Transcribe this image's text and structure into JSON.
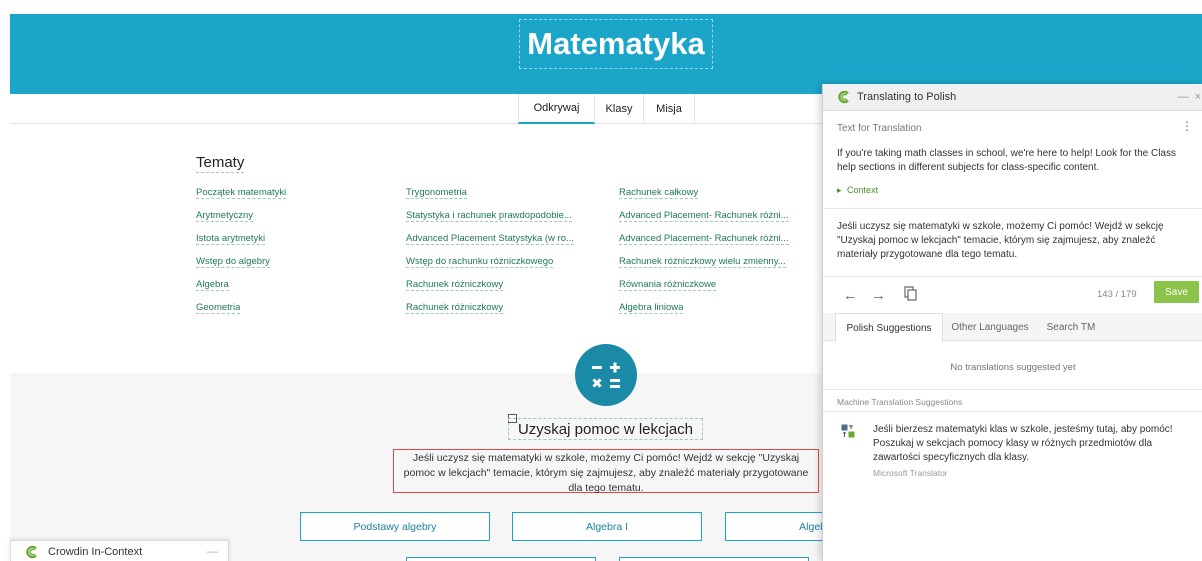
{
  "site": {
    "title": "Matematyka",
    "subnav": [
      "Odkrywaj",
      "Klasy",
      "Misja"
    ],
    "topics_heading": "Tematy",
    "topics": {
      "col1": [
        "Początek matematyki",
        "Arytmetyczny",
        "Istota arytmetyki",
        "Wstęp do algebry",
        "Algebra",
        "Geometria"
      ],
      "col2": [
        "Trygonometria",
        "Statystyka i rachunek prawdopodobie...",
        "Advanced Placement Statystyka (w ro...",
        "Wstęp do rachunku różniczkowego",
        "Rachunek różniczkowy",
        "Rachunek różniczkowy"
      ],
      "col3": [
        "Rachunek całkowy",
        "Advanced Placement- Rachunek różni...",
        "Advanced Placement- Rachunek różni...",
        "Rachunek różniczkowy wielu zmienny...",
        "Równania różniczkowe",
        "Algebra liniowa"
      ]
    },
    "help_heading": "Uzyskaj pomoc w lekcjach",
    "help_text": "Jeśli uczysz się matematyki w szkole, możemy Ci pomóc! Wejdź w sekcję \"Uzyskaj pomoc w lekcjach\" temacie, którym się zajmujesz, aby znaleźć materiały przygotowane dla tego tematu.",
    "courses": [
      "Podstawy algebry",
      "Algebra I",
      "Algeb"
    ]
  },
  "in_context_bar": {
    "label": "Crowdin In-Context",
    "minimize": "—"
  },
  "panel": {
    "title": "Translating to Polish",
    "minimize": "—",
    "close": "×",
    "section_label": "Text for Translation",
    "menu": "⋮",
    "source_text": "If you're taking math classes in school, we're here to help! Look for the Class help sections in different subjects for class-specific content.",
    "context_label": "Context",
    "translation": "Jeśli uczysz się matematyki w szkole, możemy Ci pomóc! Wejdź w sekcję \"Uzyskaj pomoc w lekcjach\" temacie, którym się zajmujesz, aby znaleźć materiały przygotowane dla tego tematu.",
    "prev": "←",
    "next": "→",
    "counter": "143 / 179",
    "save_label": "Save",
    "tabs": [
      "Polish Suggestions",
      "Other Languages",
      "Search TM"
    ],
    "no_suggestions": "No translations suggested yet",
    "mt_label": "Machine Translation Suggestions",
    "mt_text": "Jeśli bierzesz matematyki klas w szkole, jesteśmy tutaj, aby pomóc! Poszukaj w sekcjach pomocy klasy w różnych przedmiotów dla zawartości specyficznych dla klasy.",
    "mt_source": "Microsoft Translator"
  },
  "colors": {
    "hero": "#1ba6c9",
    "link": "#1f7a52",
    "save": "#8bc34a",
    "highlight_border": "#e0474c",
    "crowdin_logo": "#6aab33"
  }
}
